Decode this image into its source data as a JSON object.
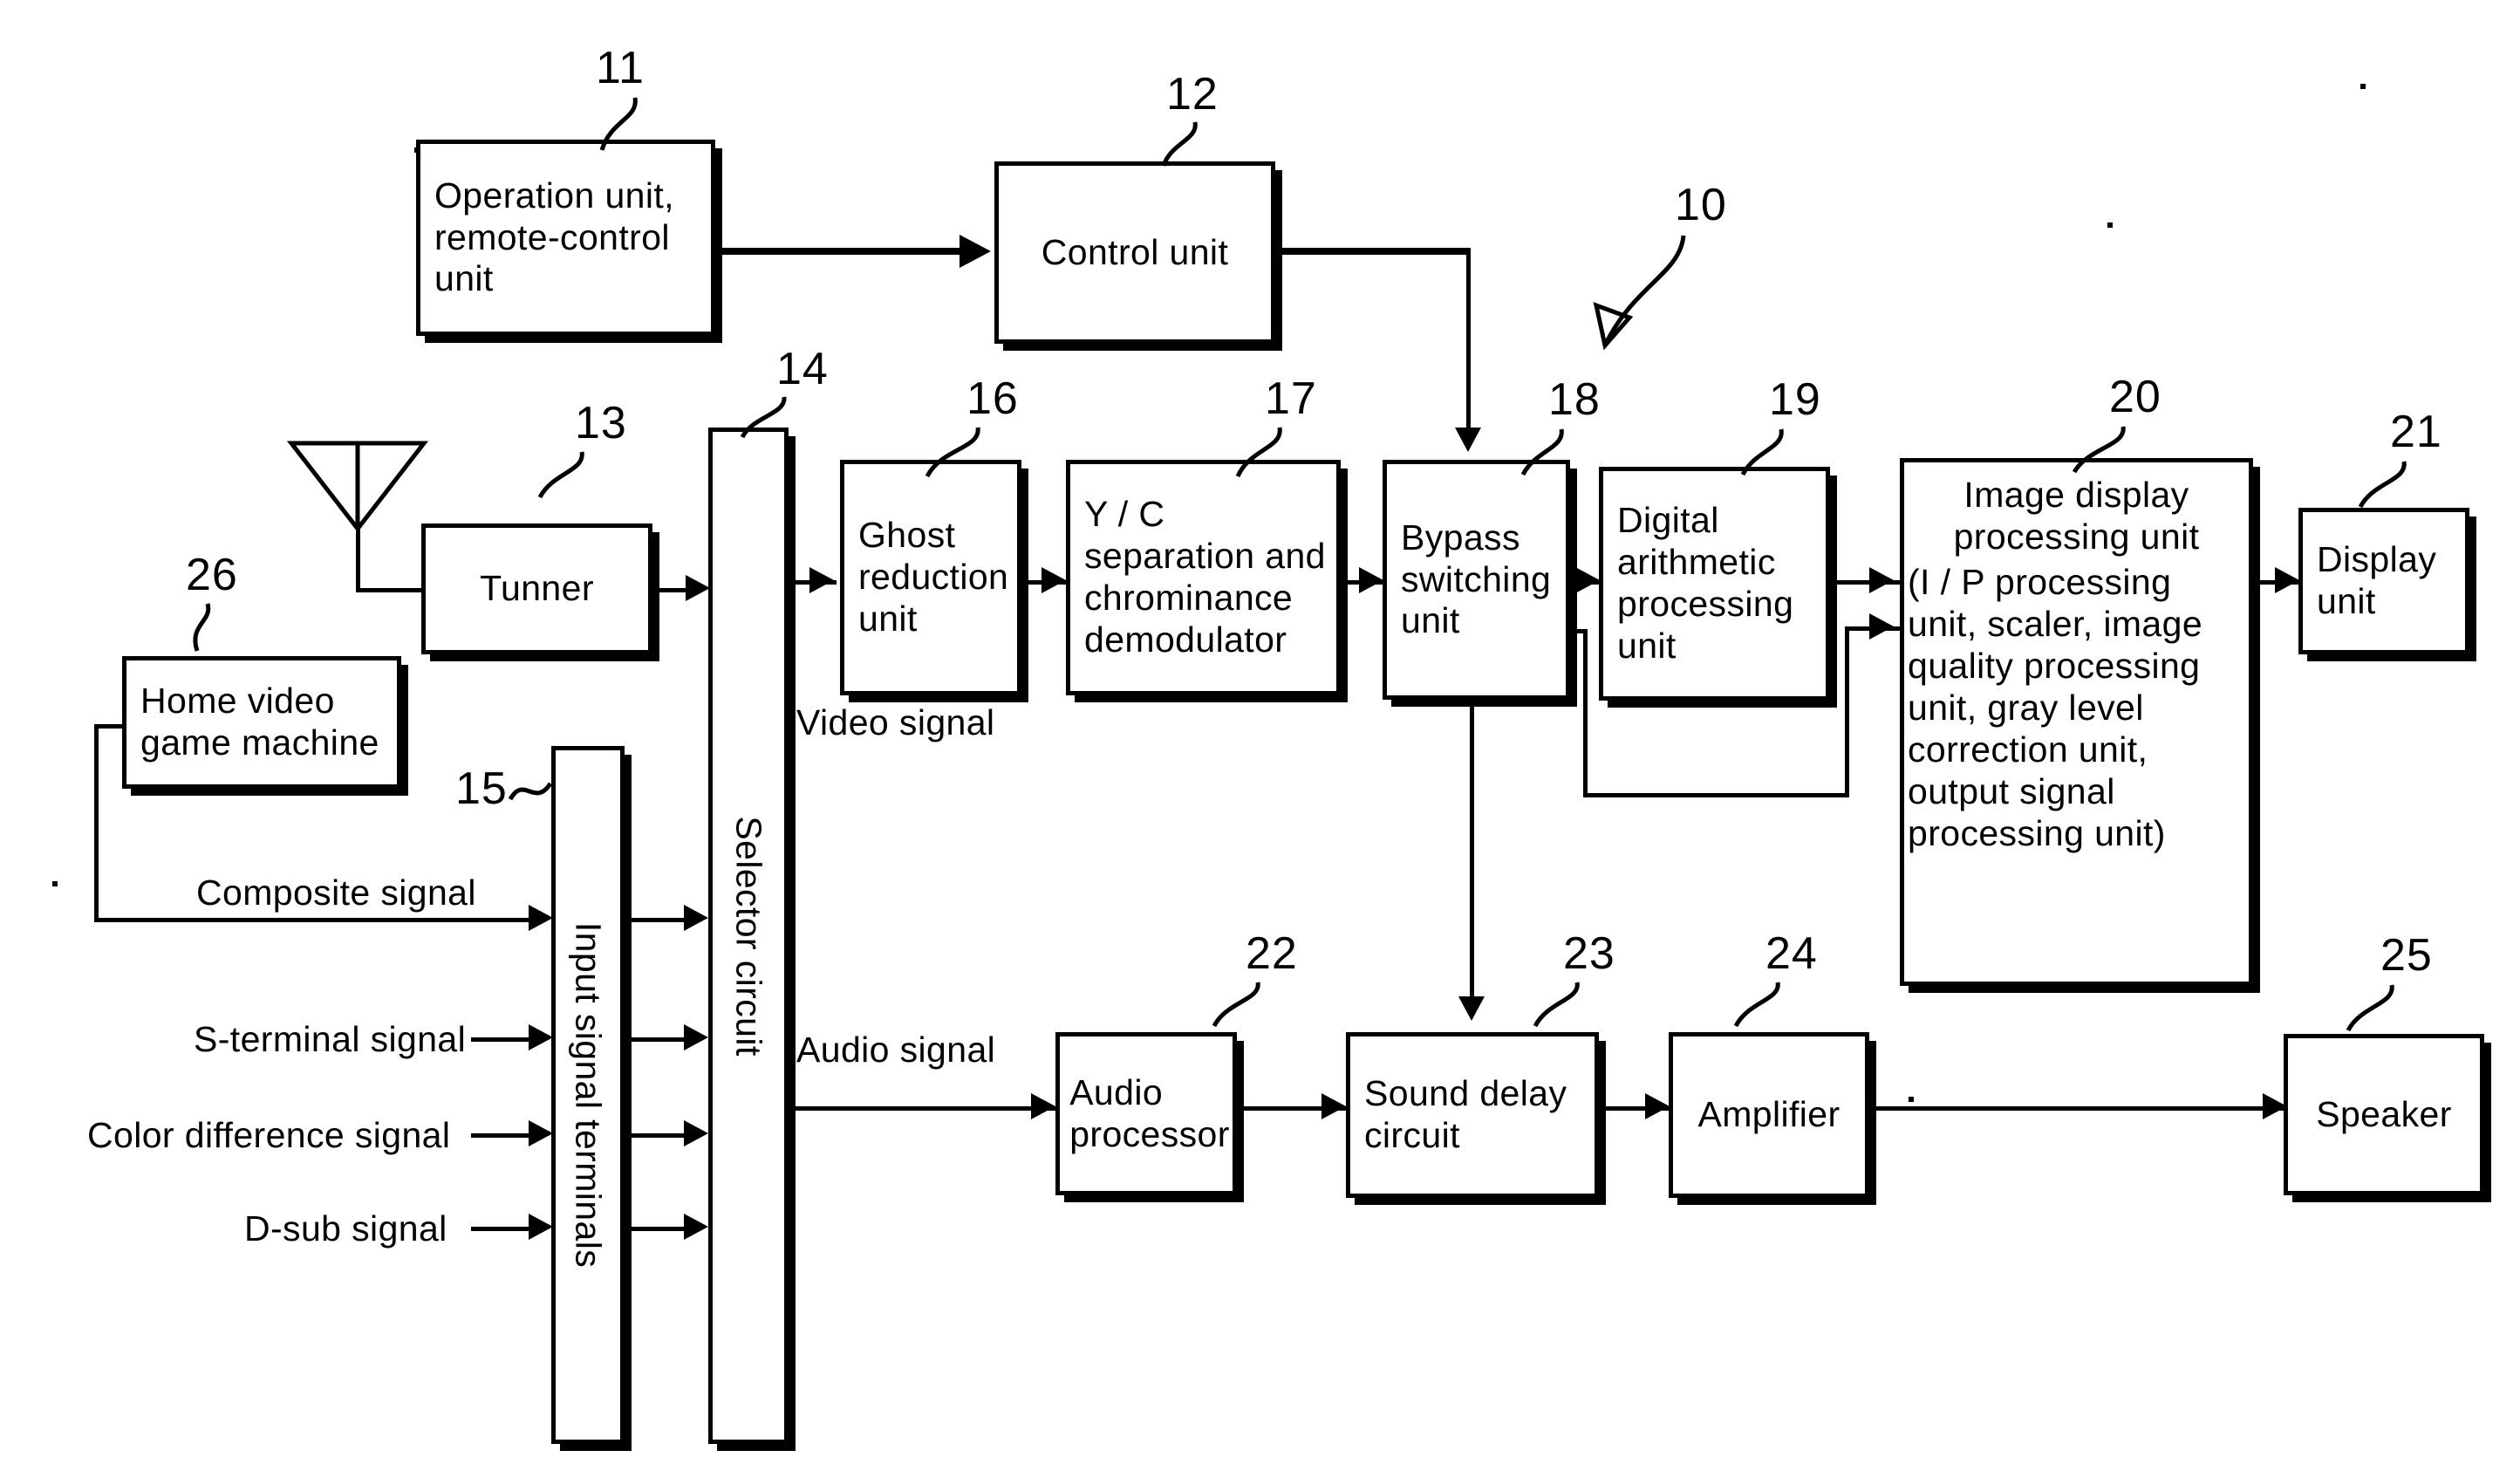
{
  "figure": {
    "kind": "patent-block-diagram",
    "system_ref": "10"
  },
  "blocks": {
    "operation_unit": {
      "ref": "11",
      "label": "Operation unit,\nremote-control\nunit"
    },
    "control_unit": {
      "ref": "12",
      "label": "Control unit"
    },
    "tunner": {
      "ref": "13",
      "label": "Tunner"
    },
    "selector_circuit": {
      "ref": "14",
      "label": "Selector circuit"
    },
    "input_signal_terminals": {
      "ref": "15",
      "label": "Input signal terminals"
    },
    "ghost_reduction_unit": {
      "ref": "16",
      "label": "Ghost\nreduction\nunit"
    },
    "yc_separation": {
      "ref": "17",
      "label": "Y / C\nseparation and\nchrominance\ndemodulator"
    },
    "bypass_switching": {
      "ref": "18",
      "label": "Bypass\nswitching\nunit"
    },
    "digital_arithmetic": {
      "ref": "19",
      "label": "Digital\narithmetic\nprocessing\nunit"
    },
    "image_display_processing": {
      "ref": "20",
      "title": "Image display\nprocessing unit",
      "detail": "(I / P processing\nunit, scaler, image\nquality processing\nunit, gray level\ncorrection unit,\noutput signal\nprocessing unit)"
    },
    "display_unit": {
      "ref": "21",
      "label": "Display\nunit"
    },
    "audio_processor": {
      "ref": "22",
      "label": "Audio\nprocessor"
    },
    "sound_delay_circuit": {
      "ref": "23",
      "label": "Sound delay\ncircuit"
    },
    "amplifier": {
      "ref": "24",
      "label": "Amplifier"
    },
    "speaker": {
      "ref": "25",
      "label": "Speaker"
    },
    "home_video_game": {
      "ref": "26",
      "label": "Home video\ngame machine"
    }
  },
  "signal_labels": {
    "composite": "Composite signal",
    "s_terminal": "S-terminal signal",
    "color_difference": "Color difference signal",
    "d_sub": "D-sub signal",
    "video": "Video signal",
    "audio": "Audio signal"
  },
  "colors": {
    "ink": "#000000",
    "paper": "#ffffff"
  }
}
